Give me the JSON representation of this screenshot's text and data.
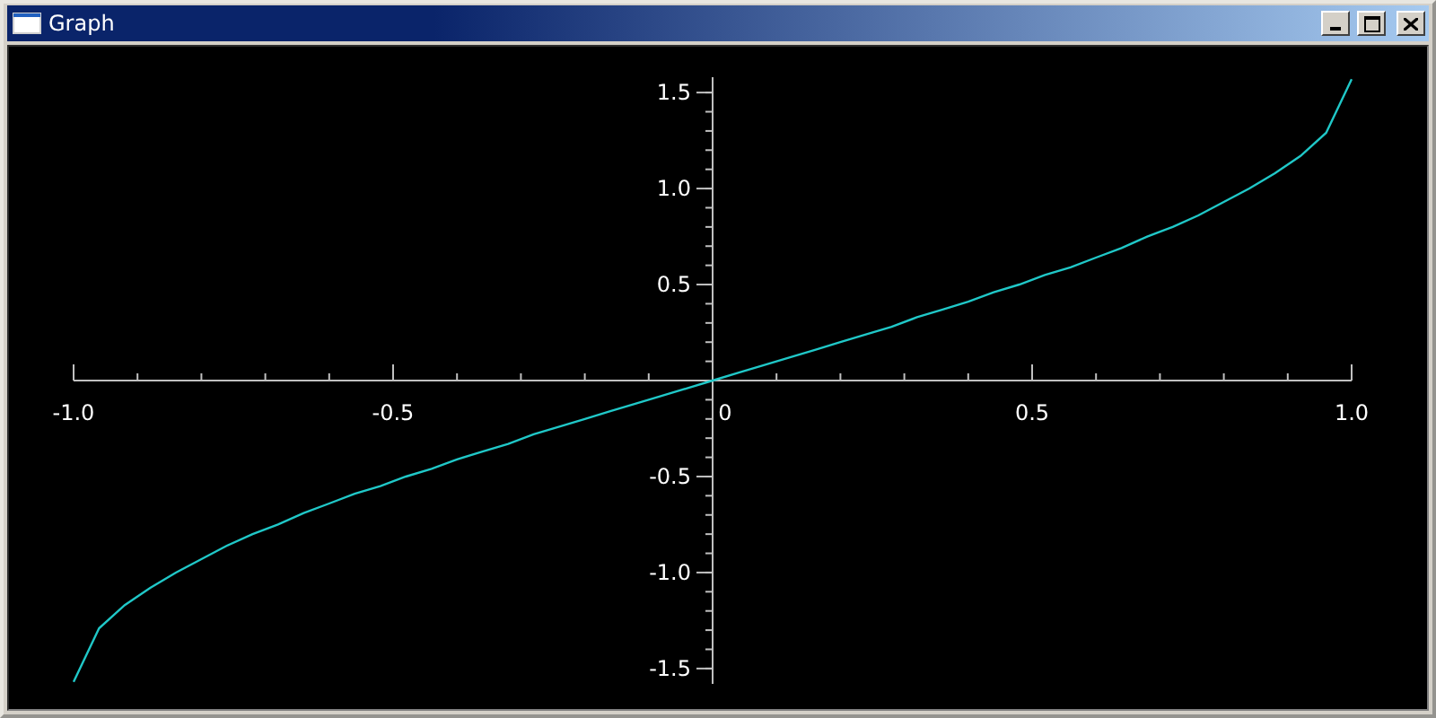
{
  "window": {
    "title": "Graph"
  },
  "chart": {
    "chart_data": {
      "type": "line",
      "xlim": [
        -1,
        1
      ],
      "ylim": [
        -1.58,
        1.58
      ],
      "xticks": [
        {
          "value": -1,
          "label": "-1.0"
        },
        {
          "value": -0.5,
          "label": "-0.5"
        },
        {
          "value": 0,
          "label": "0"
        },
        {
          "value": 0.5,
          "label": "0.5"
        },
        {
          "value": 1,
          "label": "1.0"
        }
      ],
      "yticks": [
        {
          "value": 1.5,
          "label": "1.5"
        },
        {
          "value": 1,
          "label": "1.0"
        },
        {
          "value": 0.5,
          "label": "0.5"
        },
        {
          "value": -0.5,
          "label": "-0.5"
        },
        {
          "value": -1,
          "label": "-1.0"
        },
        {
          "value": -1.5,
          "label": "-1.5"
        }
      ],
      "x": [
        -1,
        -0.96,
        -0.92,
        -0.88,
        -0.84,
        -0.8,
        -0.76,
        -0.72,
        -0.68,
        -0.64,
        -0.6,
        -0.56,
        -0.52,
        -0.48,
        -0.44,
        -0.4,
        -0.36,
        -0.32,
        -0.28,
        -0.24,
        -0.2,
        -0.16,
        -0.12,
        -0.08,
        -0.04,
        0,
        0.04,
        0.08,
        0.12,
        0.16,
        0.2,
        0.24,
        0.28,
        0.32,
        0.36,
        0.4,
        0.44,
        0.48,
        0.52,
        0.56,
        0.6,
        0.64,
        0.68,
        0.72,
        0.76,
        0.8,
        0.84,
        0.88,
        0.92,
        0.96,
        1
      ],
      "series": [
        {
          "color": "#20c8c8",
          "values": [
            -1.57,
            -1.29,
            -1.17,
            -1.08,
            -1.0,
            -0.93,
            -0.86,
            -0.8,
            -0.75,
            -0.69,
            -0.64,
            -0.59,
            -0.55,
            -0.5,
            -0.46,
            -0.41,
            -0.37,
            -0.33,
            -0.28,
            -0.24,
            -0.2,
            -0.16,
            -0.12,
            -0.08,
            -0.04,
            0,
            0.04,
            0.08,
            0.12,
            0.16,
            0.2,
            0.24,
            0.28,
            0.33,
            0.37,
            0.41,
            0.46,
            0.5,
            0.55,
            0.59,
            0.64,
            0.69,
            0.75,
            0.8,
            0.86,
            0.93,
            1.0,
            1.08,
            1.17,
            1.29,
            1.57
          ]
        }
      ]
    }
  }
}
